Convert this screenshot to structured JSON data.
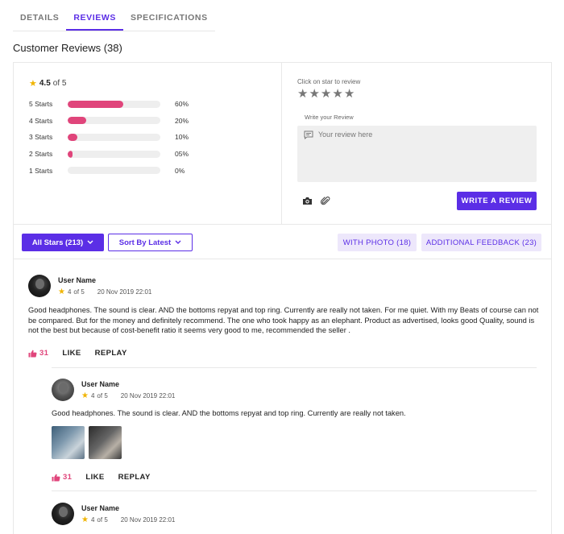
{
  "tabs": [
    {
      "label": "DETAILS"
    },
    {
      "label": "REVIEWS"
    },
    {
      "label": "SPECIFICATIONS"
    }
  ],
  "section_title": "Customer Reviews (38)",
  "summary": {
    "average": "4.5",
    "of": "of 5",
    "rows": [
      {
        "label": "5 Starts",
        "percent": "60%",
        "fill_fraction": 0.6
      },
      {
        "label": "4 Starts",
        "percent": "20%",
        "fill_fraction": 0.2
      },
      {
        "label": "3 Starts",
        "percent": "10%",
        "fill_fraction": 0.1
      },
      {
        "label": "2 Starts",
        "percent": "05%",
        "fill_fraction": 0.05
      },
      {
        "label": "1 Starts",
        "percent": "0%",
        "fill_fraction": 0
      }
    ]
  },
  "write": {
    "click_label": "Click on star to review",
    "write_label": "Write your Review",
    "placeholder": "Your review here",
    "button": "WRITE A REVIEW"
  },
  "filters": {
    "all_stars": "All Stars (213)",
    "sort": "Sort By Latest",
    "with_photo": "WITH PHOTO (18)",
    "additional": "ADDITIONAL FEEDBACK (23)"
  },
  "reviews": [
    {
      "name": "User Name",
      "rating": "4",
      "of": "of 5",
      "date": "20 Nov 2019 22:01",
      "text": "Good headphones. The sound is clear. AND the bottoms repyat and top ring. Currently are really not taken. For me quiet. With my Beats of course can not be compared. But for the money and definitely recommend. The one who took happy as an elephant. Product as advertised, looks good Quality, sound is not the best but because of cost-benefit ratio it seems very good to me, recommended the seller .",
      "likes": "31",
      "like": "LIKE",
      "reply": "REPLAY"
    },
    {
      "name": "User Name",
      "rating": "4",
      "of": "of 5",
      "date": "20 Nov 2019 22:01",
      "text": "Good headphones. The sound is clear. AND the bottoms repyat and top ring. Currently are really not taken.",
      "likes": "31",
      "like": "LIKE",
      "reply": "REPLAY"
    },
    {
      "name": "User Name",
      "rating": "4",
      "of": "of 5",
      "date": "20 Nov 2019 22:01"
    }
  ],
  "colors": {
    "accent": "#5b2ee6",
    "bar_fill": "#e0457b",
    "star": "#f0b400"
  }
}
